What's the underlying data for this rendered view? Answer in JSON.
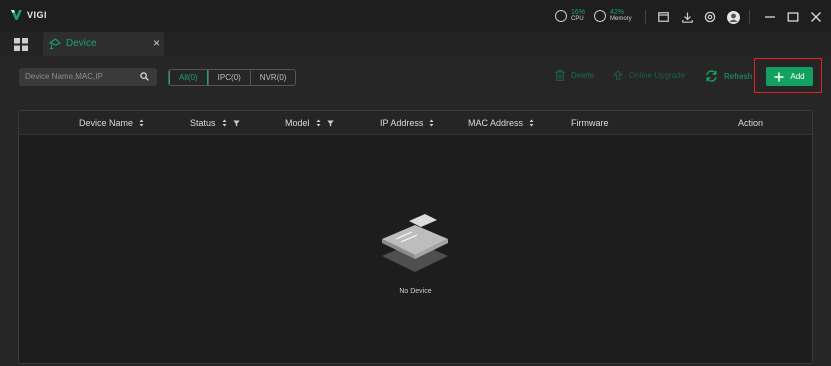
{
  "app": {
    "logo_text": "VIGI"
  },
  "stats": {
    "cpu": {
      "value": "16%",
      "label": "CPU"
    },
    "memory": {
      "value": "42%",
      "label": "Memory"
    }
  },
  "tabs": [
    {
      "label": "Device"
    }
  ],
  "toolbar": {
    "search_placeholder": "Device Name,MAC,IP",
    "filters": [
      "All(0)",
      "IPC(0)",
      "NVR(0)"
    ],
    "delete_label": "Delete",
    "upgrade_label": "Online Upgrade",
    "refresh_label": "Refresh",
    "add_label": "Add"
  },
  "table": {
    "columns": [
      "Device Name",
      "Status",
      "Model",
      "IP Address",
      "MAC Address",
      "Firmware",
      "Action"
    ],
    "rows": [],
    "empty_text": "No Device"
  },
  "colors": {
    "accent": "#1aa36a",
    "highlight": "#e02222"
  }
}
